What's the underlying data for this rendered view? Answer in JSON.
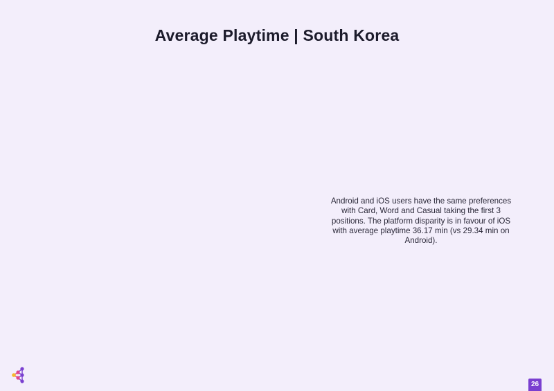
{
  "page": {
    "title": "Average Playtime | South Korea",
    "body_text": "Android and iOS users have the same preferences with Card, Word and Casual taking the first 3 positions. The platform disparity is in favour of iOS with average playtime 36.17 min (vs 29.34 min on Android).",
    "page_number": "26"
  },
  "brand": {
    "logo_icon": "dot-network-logo-icon",
    "colors": {
      "background": "#f3eefb",
      "accent": "#7a3fd0",
      "logo_yellow": "#f5b82e",
      "logo_pink": "#e0448a",
      "logo_purple": "#7a3fd0"
    }
  }
}
